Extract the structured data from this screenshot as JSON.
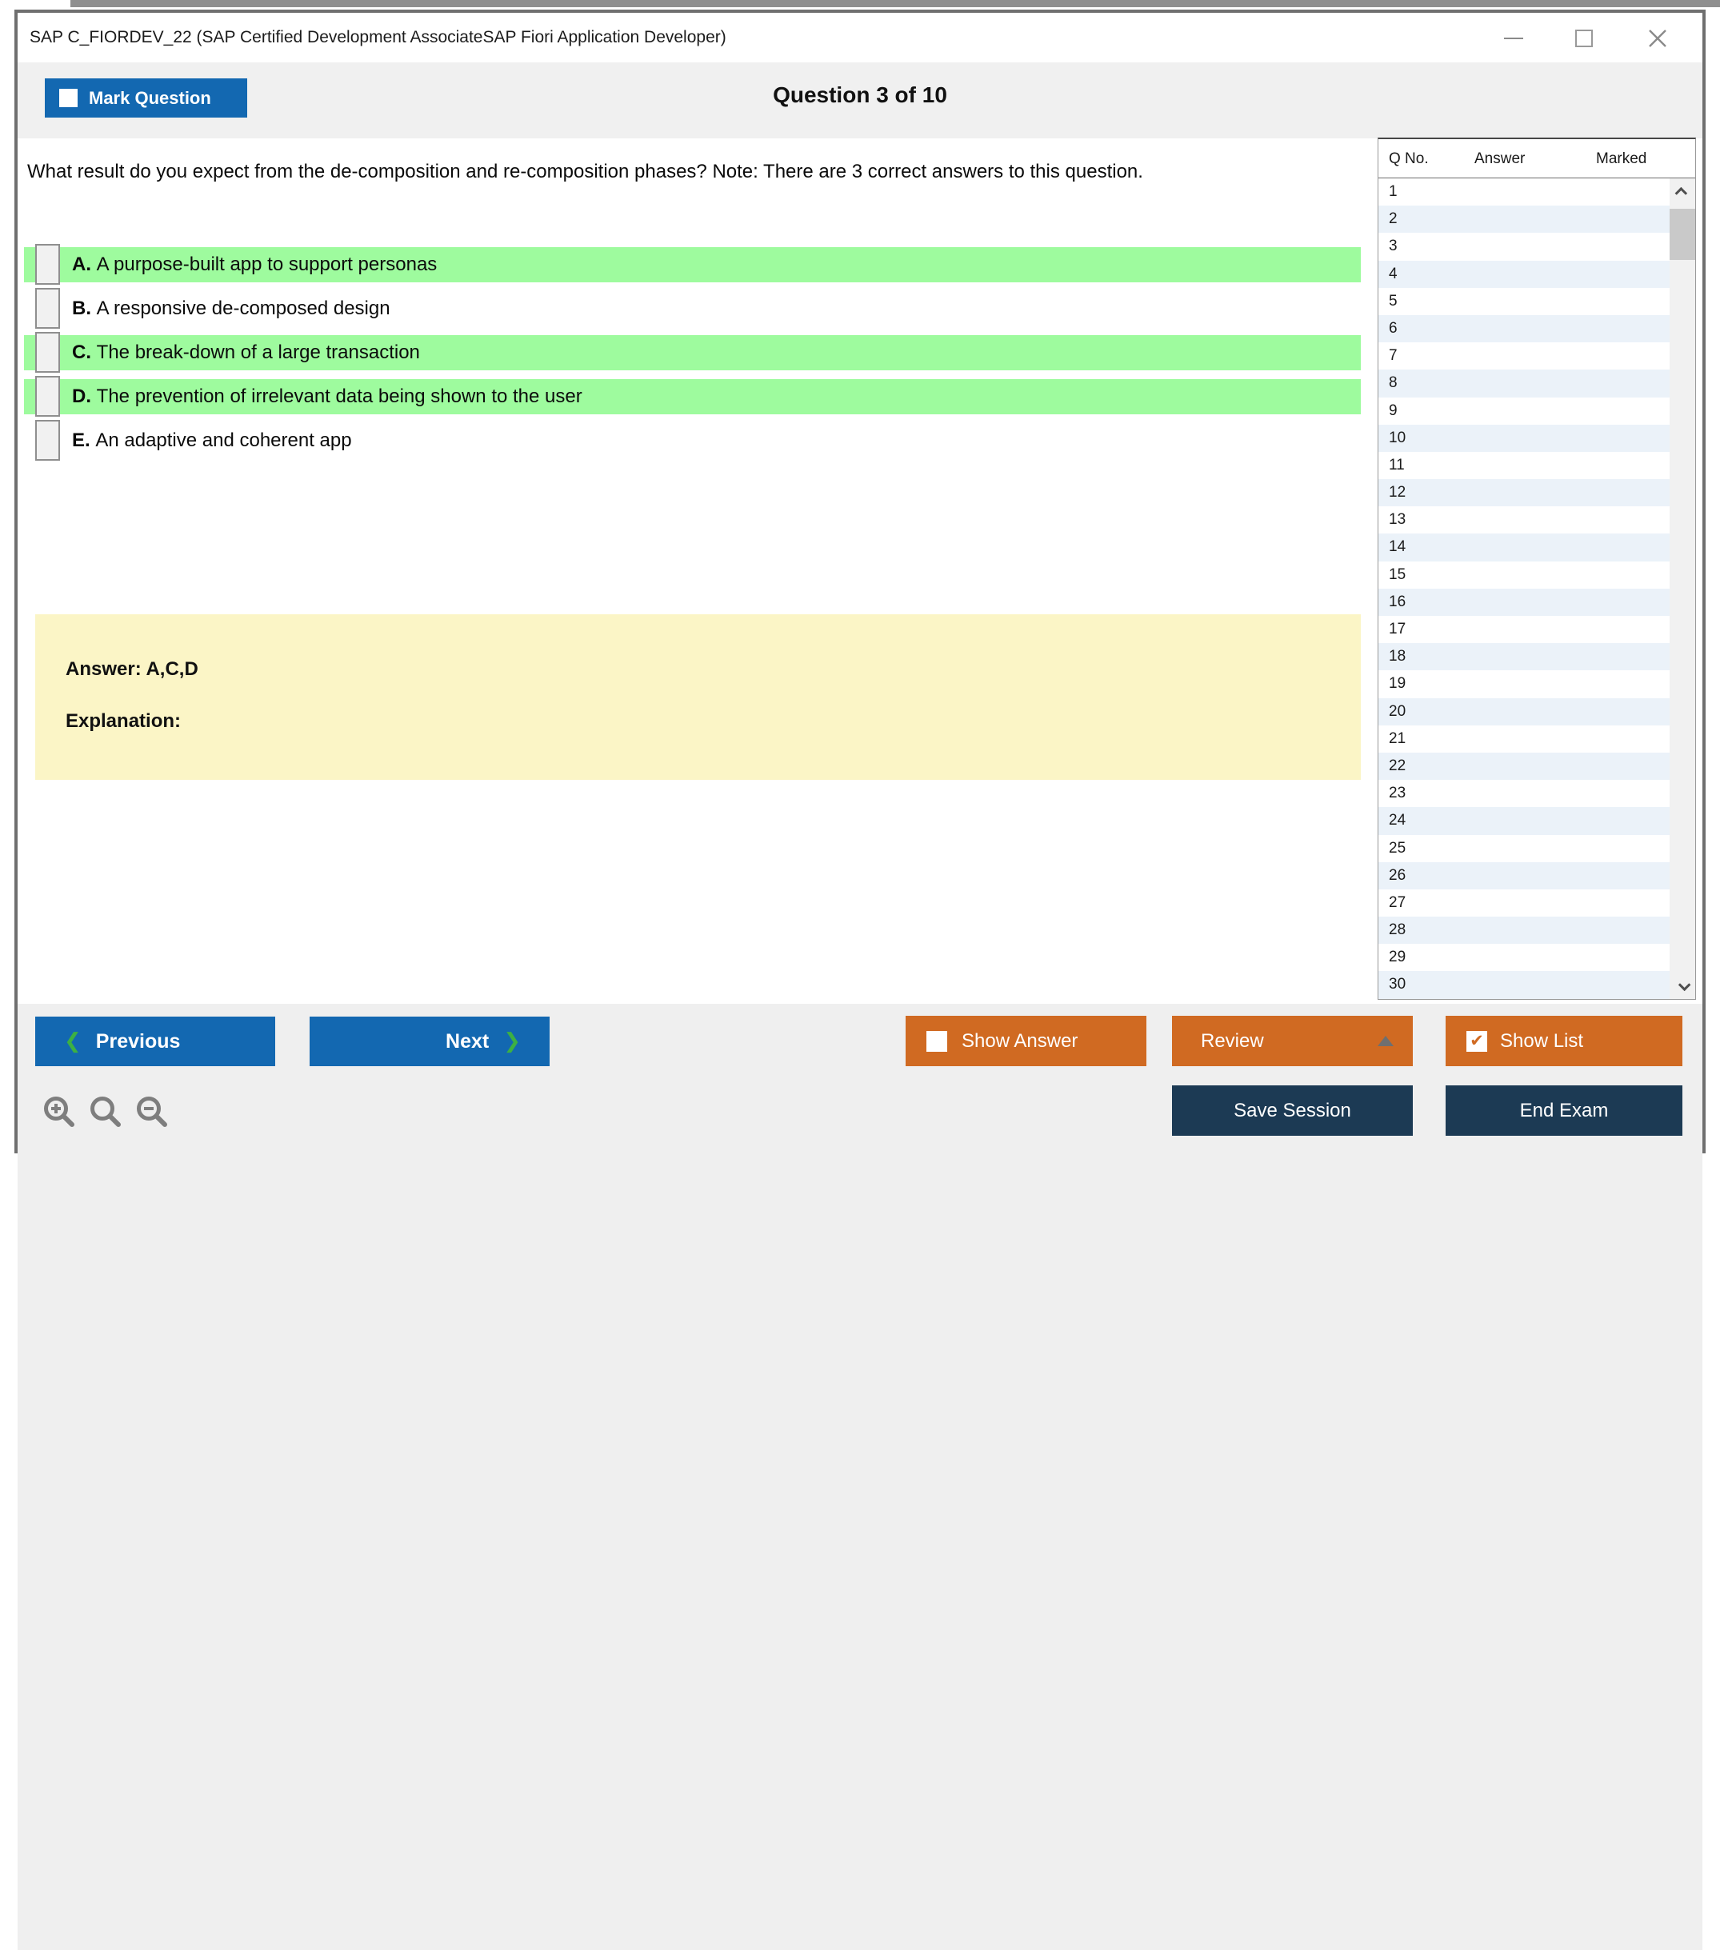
{
  "window": {
    "title": "SAP C_FIORDEV_22 (SAP Certified Development AssociateSAP Fiori Application Developer)"
  },
  "header": {
    "mark_question_label": "Mark Question",
    "question_counter": "Question 3 of 10"
  },
  "question": {
    "text": "What result do you expect from the de-composition and re-composition phases? Note: There are 3 correct answers to this question."
  },
  "options": [
    {
      "letter": "A.",
      "text": "A purpose-built app to support personas",
      "highlighted": true,
      "checked": false
    },
    {
      "letter": "B.",
      "text": "A responsive de-composed design",
      "highlighted": false,
      "checked": false
    },
    {
      "letter": "C.",
      "text": "The break-down of a large transaction",
      "highlighted": true,
      "checked": false
    },
    {
      "letter": "D.",
      "text": "The prevention of irrelevant data being shown to the user",
      "highlighted": true,
      "checked": false
    },
    {
      "letter": "E.",
      "text": "An adaptive and coherent app",
      "highlighted": false,
      "checked": false
    }
  ],
  "answer_box": {
    "answer_label": "Answer: A,C,D",
    "explanation_label": "Explanation:"
  },
  "sidebar": {
    "columns": [
      "Q No.",
      "Answer",
      "Marked"
    ],
    "rows": [
      "1",
      "2",
      "3",
      "4",
      "5",
      "6",
      "7",
      "8",
      "9",
      "10",
      "11",
      "12",
      "13",
      "14",
      "15",
      "16",
      "17",
      "18",
      "19",
      "20",
      "21",
      "22",
      "23",
      "24",
      "25",
      "26",
      "27",
      "28",
      "29",
      "30"
    ]
  },
  "footer": {
    "previous_label": "Previous",
    "next_label": "Next",
    "show_answer_label": "Show Answer",
    "review_label": "Review",
    "show_list_label": "Show List",
    "save_session_label": "Save Session",
    "end_exam_label": "End Exam"
  },
  "icons": {
    "minimize": "horizontal-bar",
    "maximize": "square-outline",
    "close": "x-cross",
    "mark_question_checkbox": "white-square-unchecked",
    "show_answer_checkbox": "white-square-unchecked",
    "show_list_checkbox": "white-square-checked",
    "review_caret": "up-triangle",
    "previous_chevron": "❮",
    "next_chevron": "❯",
    "show_list_check": "✔",
    "zoom_in": "magnifier-plus",
    "zoom_reset": "magnifier",
    "zoom_out": "magnifier-minus",
    "scroll_up": "chevron-up",
    "scroll_down": "chevron-down"
  },
  "colors": {
    "primary_blue": "#1368b1",
    "accent_orange": "#d06a22",
    "dark_navy": "#1c3a54",
    "option_highlight_green": "#9efb9e",
    "answer_box_yellow": "#fbf5c6",
    "alt_row_blue": "#ebf2f9",
    "chevron_green": "#3cb043",
    "strip_gray": "#f0f0f0",
    "window_border_gray": "#6f6f6f"
  }
}
